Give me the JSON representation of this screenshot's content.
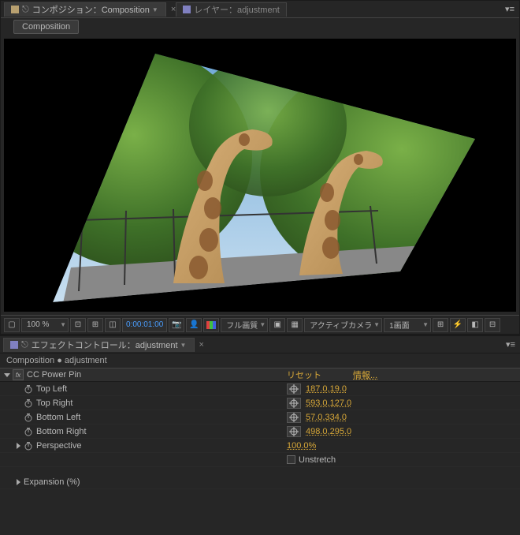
{
  "tabs": {
    "composition_tab": "コンポジション：Composition",
    "layer_tab": "レイヤー：adjustment",
    "sub_tab": "Composition"
  },
  "toolbar": {
    "zoom": "100 %",
    "timecode": "0:00:01:00",
    "quality": "フル画質",
    "camera": "アクティブカメラ",
    "views": "1画面"
  },
  "effects": {
    "panel_tab": "エフェクトコントロール：adjustment",
    "breadcrumb": "Composition ● adjustment",
    "effect_name": "CC Power Pin",
    "reset": "リセット",
    "info": "情報...",
    "props": {
      "top_left": {
        "label": "Top Left",
        "value": "187.0,19.0"
      },
      "top_right": {
        "label": "Top Right",
        "value": "593.0,127.0"
      },
      "bottom_left": {
        "label": "Bottom Left",
        "value": "57.0,334.0"
      },
      "bottom_right": {
        "label": "Bottom Right",
        "value": "498.0,295.0"
      },
      "perspective": {
        "label": "Perspective",
        "value": "100.0%"
      },
      "unstretch": {
        "label": "Unstretch"
      },
      "expansion": {
        "label": "Expansion (%)"
      }
    }
  }
}
